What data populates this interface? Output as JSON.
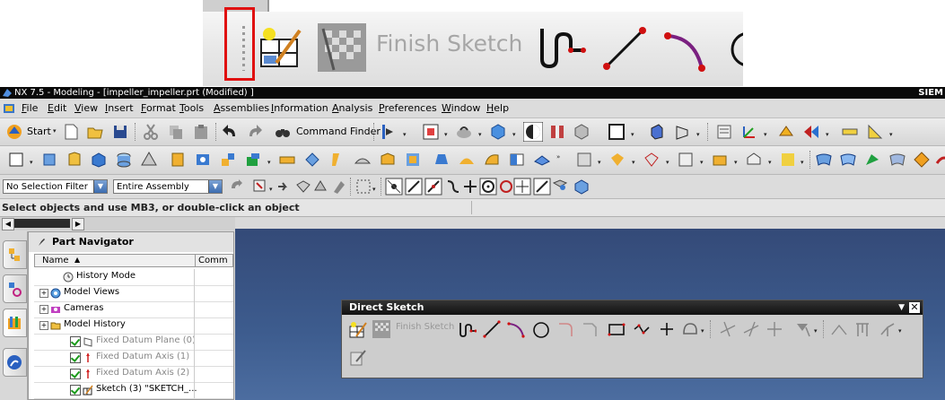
{
  "zoom_inset": {
    "finish_sketch_label": "Finish Sketch"
  },
  "window": {
    "title": "NX 7.5 - Modeling - [impeller_impeller.prt (Modified) ]",
    "brand": "SIEM"
  },
  "menu": {
    "items": [
      "File",
      "Edit",
      "View",
      "Insert",
      "Format",
      "Tools",
      "Assemblies",
      "Information",
      "Analysis",
      "Preferences",
      "Window",
      "Help"
    ]
  },
  "toolbar1": {
    "start_label": "Start",
    "command_finder_label": "Command Finder"
  },
  "selection_bar": {
    "filter_value": "No Selection Filter",
    "scope_value": "Entire Assembly"
  },
  "status": {
    "text": "Select objects and use MB3, or double-click an object"
  },
  "part_navigator": {
    "title": "Part Navigator",
    "columns": [
      "Name",
      "Comm"
    ],
    "rows": [
      {
        "label": "History Mode",
        "indent": 1,
        "dim": false,
        "icon": "history-icon"
      },
      {
        "label": "Model Views",
        "indent": 0,
        "dim": false,
        "icon": "model-views-icon"
      },
      {
        "label": "Cameras",
        "indent": 0,
        "dim": false,
        "icon": "camera-icon"
      },
      {
        "label": "Model History",
        "indent": 0,
        "dim": false,
        "icon": "folder-icon"
      },
      {
        "label": "Fixed Datum Plane (0)",
        "indent": 2,
        "dim": true,
        "icon": "datum-plane-icon"
      },
      {
        "label": "Fixed Datum Axis (1)",
        "indent": 2,
        "dim": true,
        "icon": "datum-axis-icon"
      },
      {
        "label": "Fixed Datum Axis (2)",
        "indent": 2,
        "dim": true,
        "icon": "datum-axis-icon"
      },
      {
        "label": "Sketch (3) \"SKETCH_...",
        "indent": 2,
        "dim": false,
        "icon": "sketch-icon"
      }
    ]
  },
  "direct_sketch": {
    "title": "Direct Sketch",
    "finish_label": "Finish Sketch"
  },
  "colors": {
    "graphics_bg": "#3d5c8e",
    "highlight": "#e01010",
    "title_bar": "#0a0a0a"
  }
}
